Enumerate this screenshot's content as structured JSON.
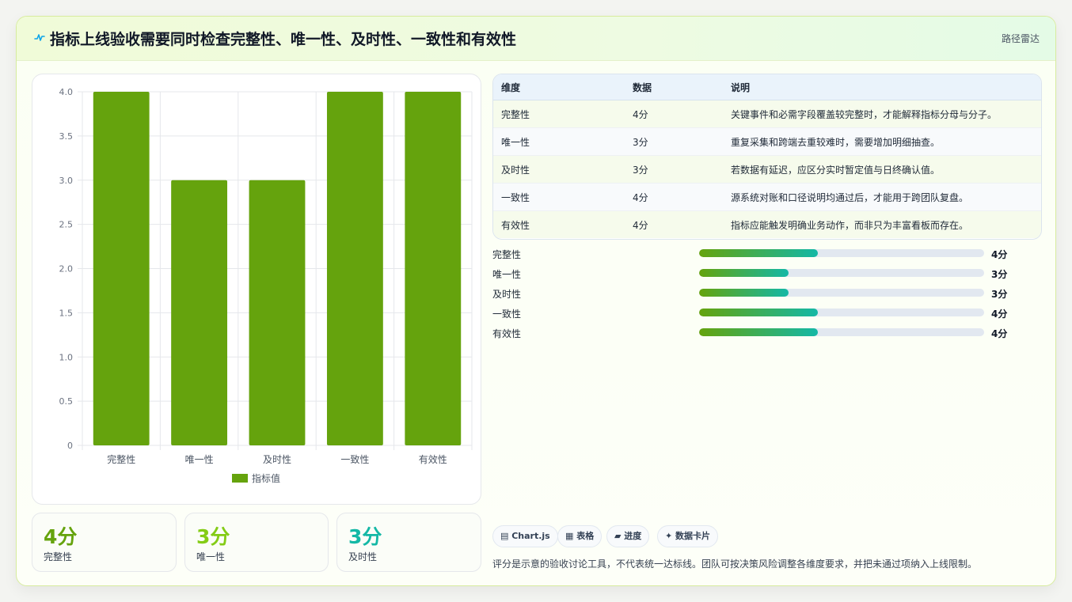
{
  "header": {
    "title": "指标上线验收需要同时检查完整性、唯一性、及时性、一致性和有效性",
    "tag": "路径雷达",
    "icon": "pulse-icon"
  },
  "chart_data": {
    "type": "bar",
    "categories": [
      "完整性",
      "唯一性",
      "及时性",
      "一致性",
      "有效性"
    ],
    "series": [
      {
        "name": "指标值",
        "values": [
          4,
          3,
          3,
          4,
          4
        ],
        "color": "#65a30d"
      }
    ],
    "ylim": [
      0,
      4
    ],
    "yticks": [
      "0",
      "0.5",
      "1.0",
      "1.5",
      "2.0",
      "2.5",
      "3.0",
      "3.5",
      "4.0"
    ],
    "grid": true,
    "legend": "bottom"
  },
  "kpis": [
    {
      "value": "4分",
      "label": "完整性",
      "color": "#65a30d"
    },
    {
      "value": "3分",
      "label": "唯一性",
      "color": "#84cc16"
    },
    {
      "value": "3分",
      "label": "及时性",
      "color": "#14b8a6"
    }
  ],
  "table": {
    "headers": [
      "维度",
      "数据",
      "说明"
    ],
    "rows": [
      {
        "dim": "完整性",
        "data": "4分",
        "desc": "关键事件和必需字段覆盖较完整时，才能解释指标分母与分子。"
      },
      {
        "dim": "唯一性",
        "data": "3分",
        "desc": "重复采集和跨端去重较难时，需要增加明细抽查。"
      },
      {
        "dim": "及时性",
        "data": "3分",
        "desc": "若数据有延迟，应区分实时暂定值与日终确认值。"
      },
      {
        "dim": "一致性",
        "data": "4分",
        "desc": "源系统对账和口径说明均通过后，才能用于跨团队复盘。"
      },
      {
        "dim": "有效性",
        "data": "4分",
        "desc": "指标应能触发明确业务动作，而非只为丰富看板而存在。"
      }
    ]
  },
  "progress": [
    {
      "label": "完整性",
      "score": "4分",
      "fraction": 0.4167
    },
    {
      "label": "唯一性",
      "score": "3分",
      "fraction": 0.3125
    },
    {
      "label": "及时性",
      "score": "3分",
      "fraction": 0.3125
    },
    {
      "label": "一致性",
      "score": "4分",
      "fraction": 0.4167
    },
    {
      "label": "有效性",
      "score": "4分",
      "fraction": 0.4167
    }
  ],
  "chips": [
    {
      "icon": "chart-icon",
      "label": "▤ Chart.js"
    },
    {
      "icon": "table-icon",
      "label": "▦ 表格"
    },
    {
      "icon": "progress-icon",
      "label": "▰ 进度"
    },
    {
      "icon": "sparkle-icon",
      "label": "✦ 数据卡片"
    }
  ],
  "footnote": "评分是示意的验收讨论工具，不代表统一达标线。团队可按决策风险调整各维度要求，并把未通过项纳入上线限制。"
}
